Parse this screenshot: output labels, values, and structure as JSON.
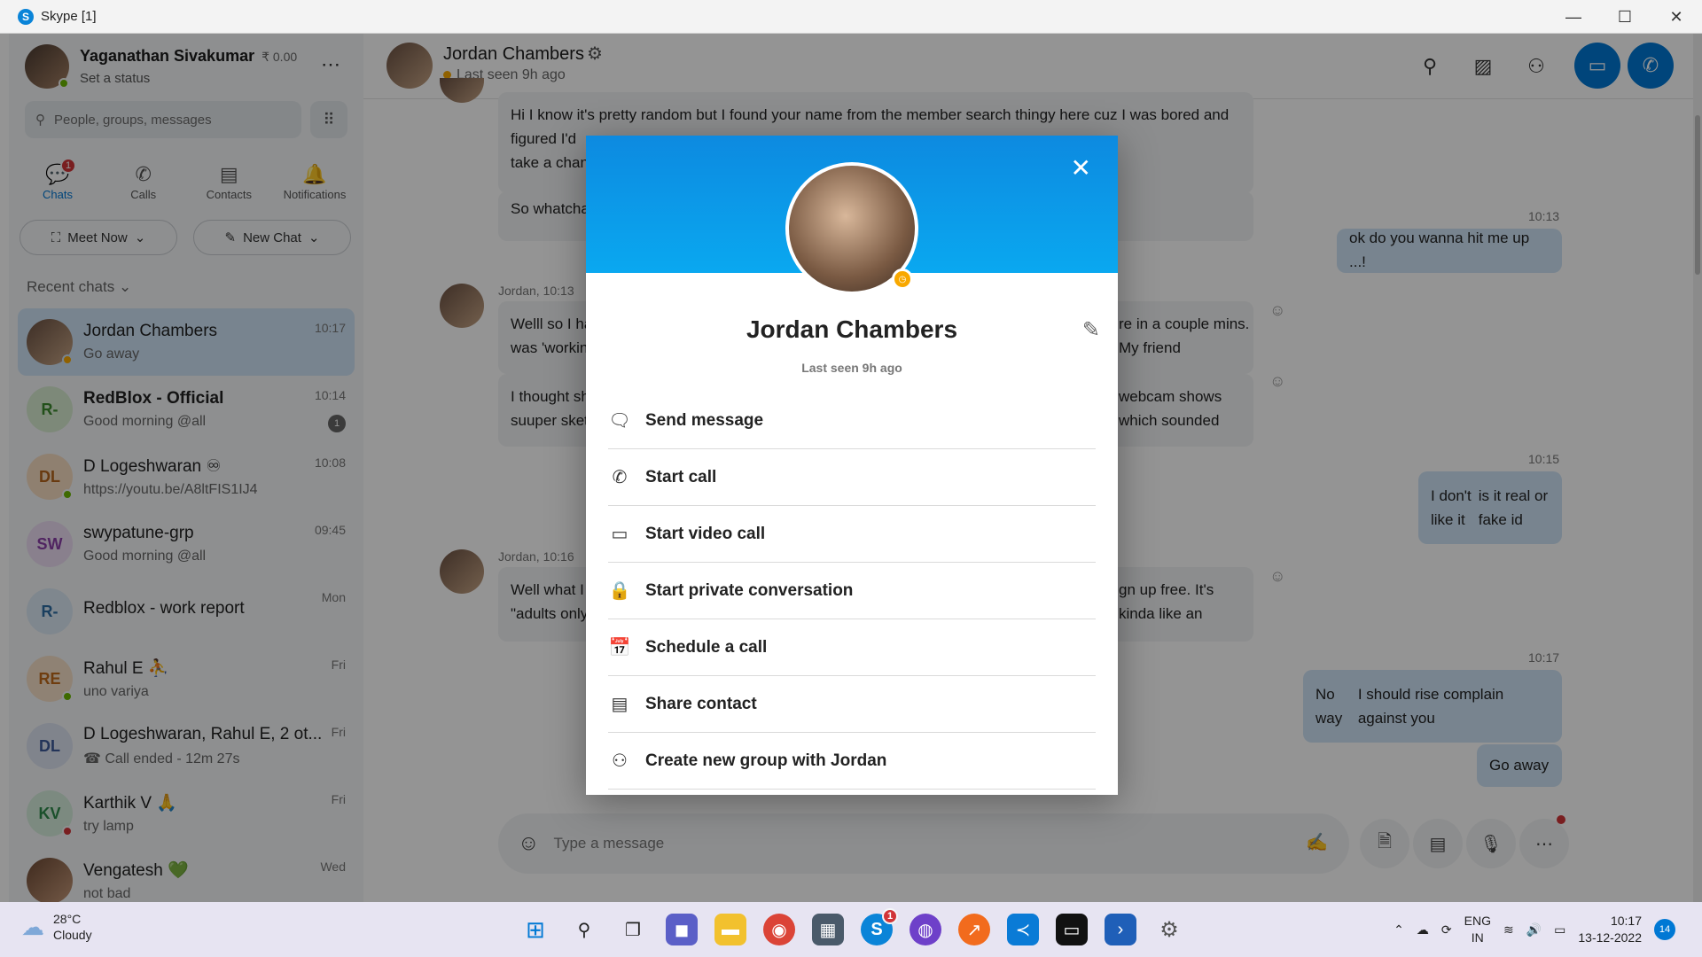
{
  "window": {
    "title": "Skype [1]",
    "app_icon": "S"
  },
  "me": {
    "name": "Yaganathan Sivakumar",
    "credit": "₹ 0.00",
    "status": "Set a status"
  },
  "search": {
    "placeholder": "People, groups, messages"
  },
  "nav": {
    "chats": "Chats",
    "calls": "Calls",
    "contacts": "Contacts",
    "notifications": "Notifications",
    "chats_badge": "1"
  },
  "buttons": {
    "meet_now": "Meet Now",
    "new_chat": "New Chat"
  },
  "recent_heading": "Recent chats ⌄",
  "chats": [
    {
      "name": "Jordan Chambers",
      "msg": "Go away",
      "time": "10:17",
      "initials": "",
      "bg": "#a07a5f",
      "presence": "#f8a800"
    },
    {
      "name": "RedBlox - Official",
      "msg": "Good morning @all",
      "time": "10:14",
      "initials": "R-",
      "bg": "#d7ecd0",
      "fg": "#3c8a2e",
      "badge": "1"
    },
    {
      "name": "D Logeshwaran ♾",
      "msg": "https://youtu.be/A8ltFIS1IJ4",
      "time": "10:08",
      "initials": "DL",
      "bg": "#f6dcc2",
      "fg": "#b5651d",
      "presence": "#6bb700"
    },
    {
      "name": "swypatune-grp",
      "msg": "Good morning @all",
      "time": "09:45",
      "initials": "SW",
      "bg": "#ecdcf3",
      "fg": "#8a3fa8"
    },
    {
      "name": "Redblox - work report",
      "msg": "",
      "time": "Mon",
      "initials": "R-",
      "bg": "#dbe9f4",
      "fg": "#2e6da4"
    },
    {
      "name": "Rahul E ⛹",
      "msg": "uno variya",
      "time": "Fri",
      "initials": "RE",
      "bg": "#f6e1c8",
      "fg": "#c06a1a",
      "presence": "#6bb700"
    },
    {
      "name": "D Logeshwaran, Rahul E, 2 ot...",
      "msg": "☎ Call ended - 12m 27s",
      "time": "Fri",
      "initials": "DL",
      "bg": "#dde3f2",
      "fg": "#3d5a9a"
    },
    {
      "name": "Karthik V 🙏",
      "msg": "try lamp",
      "time": "Fri",
      "initials": "KV",
      "bg": "#d6eedc",
      "fg": "#2e8a4a",
      "presence": "#d13438"
    },
    {
      "name": "Vengatesh 💚",
      "msg": "not bad",
      "time": "Wed",
      "initials": "",
      "bg": "#b8866a"
    }
  ],
  "conversation": {
    "contact_name": "Jordan Chambers",
    "contact_status": "Last seen 9h ago",
    "messages": [
      {
        "who": "them",
        "text1": "Hi I know it's pretty random but I found your name from the member search thingy here cuz I was bored and figured I'd",
        "text2": "take a chance and hit ya up :)"
      },
      {
        "who": "them",
        "text1": "So whatcha"
      },
      {
        "time": "10:13"
      },
      {
        "who": "me",
        "text1": "ok do you wanna hit me up ...!"
      },
      {
        "meta": "Jordan, 10:13"
      },
      {
        "who": "them",
        "text1": "Welll so I ha",
        "text1b": "re in a couple mins. My friend",
        "text2": "was 'workin"
      },
      {
        "who": "them",
        "text1": "I thought sh",
        "text1b": "webcam shows which sounded",
        "text2": "suuper sket"
      },
      {
        "time": "10:15"
      },
      {
        "who": "me",
        "text1": "I don't like it",
        "text2": "is it real or fake id"
      },
      {
        "meta": "Jordan, 10:16"
      },
      {
        "who": "them",
        "text1": "Well what I",
        "text1b": "gn up free. It's kinda like an",
        "text2": "\"adults only"
      },
      {
        "time": "10:17"
      },
      {
        "who": "me",
        "text1": "No way",
        "text2": "I should rise complain against you"
      },
      {
        "who": "me",
        "text1": "Go away"
      }
    ],
    "composer_placeholder": "Type a message"
  },
  "profile_modal": {
    "name": "Jordan Chambers",
    "last_seen": "Last seen 9h ago",
    "actions": [
      {
        "label": "Send message",
        "icon": "chat-bubble-icon"
      },
      {
        "label": "Start call",
        "icon": "phone-icon"
      },
      {
        "label": "Start video call",
        "icon": "video-camera-icon"
      },
      {
        "label": "Start private conversation",
        "icon": "lock-icon"
      },
      {
        "label": "Schedule a call",
        "icon": "calendar-clock-icon"
      },
      {
        "label": "Share contact",
        "icon": "contact-card-icon"
      },
      {
        "label": "Create new group with Jordan",
        "icon": "people-icon"
      }
    ]
  },
  "taskbar": {
    "weather_temp": "28°C",
    "weather_desc": "Cloudy",
    "lang1": "ENG",
    "lang2": "IN",
    "time": "10:17",
    "date": "13-12-2022",
    "notif_count": "14",
    "skype_badge": "1"
  },
  "colors": {
    "accent": "#0078d4",
    "away": "#f8a800",
    "selected_chat": "#cfe4f7"
  }
}
